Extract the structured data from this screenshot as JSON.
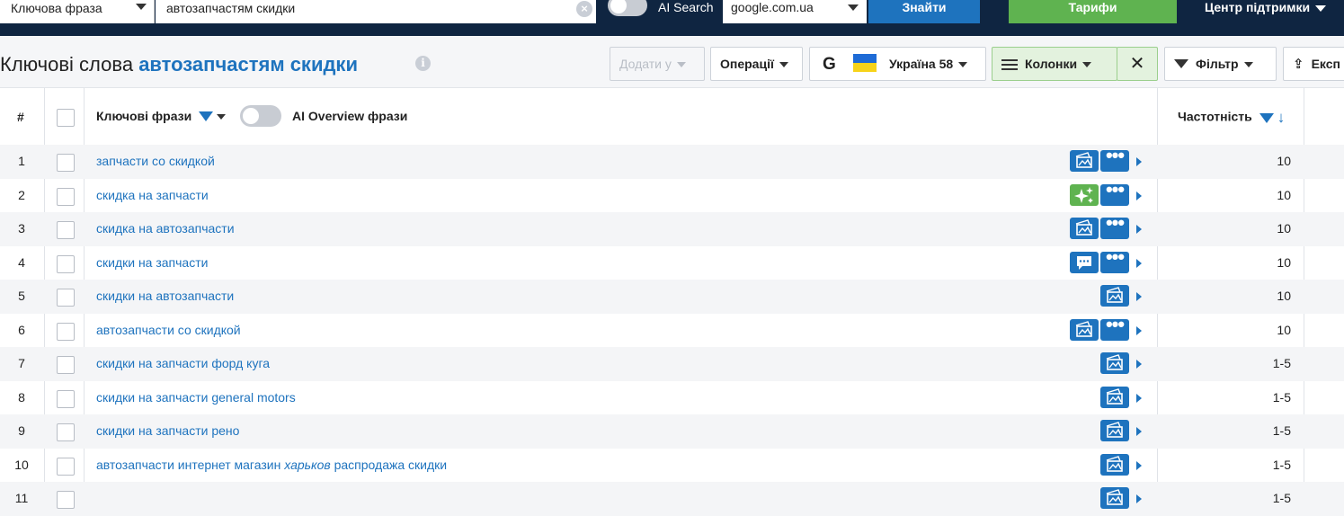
{
  "search": {
    "query_type": "Ключова фраза",
    "query": "автозапчастям скидки",
    "ai_search_label": "AI Search",
    "engine": "google.com.ua",
    "find_label": "Знайти",
    "plans_label": "Тарифи",
    "support_label": "Центр підтримки"
  },
  "header": {
    "title_prefix": "Ключові слова",
    "title_keyword": "автозапчастям скидки",
    "info_glyph": "i",
    "add_to_label": "Додати у",
    "operations_label": "Операції",
    "engine_letter": "G",
    "region_label": "Україна 58",
    "columns_label": "Колонки",
    "columns_close": "✕",
    "filter_label": "Фільтр",
    "export_label": "Експ",
    "export_icon": "upload-icon"
  },
  "table": {
    "col_num": "#",
    "col_keywords": "Ключові фрази",
    "col_aio": "AI Overview фрази",
    "col_freq": "Частотність",
    "sort_arrow": "↓",
    "rows": [
      {
        "num": "1",
        "kw": "запчасти со скидкой",
        "kw_italic": "",
        "kw_tail": "",
        "icon": "serp-features-icon",
        "more": true,
        "freq": "10"
      },
      {
        "num": "2",
        "kw": "скидка на запчасти",
        "kw_italic": "",
        "kw_tail": "",
        "icon": "ai-sparkle-icon",
        "more": true,
        "freq": "10"
      },
      {
        "num": "3",
        "kw": "скидка на автозапчасти",
        "kw_italic": "",
        "kw_tail": "",
        "icon": "serp-features-icon",
        "more": true,
        "freq": "10"
      },
      {
        "num": "4",
        "kw": "скидки на запчасти",
        "kw_italic": "",
        "kw_tail": "",
        "icon": "chat-icon",
        "more": true,
        "freq": "10"
      },
      {
        "num": "5",
        "kw": "скидки на автозапчасти",
        "kw_italic": "",
        "kw_tail": "",
        "icon": "serp-features-icon",
        "more": false,
        "freq": "10"
      },
      {
        "num": "6",
        "kw": "автозапчасти со скидкой",
        "kw_italic": "",
        "kw_tail": "",
        "icon": "serp-features-icon",
        "more": true,
        "freq": "10"
      },
      {
        "num": "7",
        "kw": "скидки на запчасти форд куга",
        "kw_italic": "",
        "kw_tail": "",
        "icon": "serp-features-icon",
        "more": false,
        "freq": "1-5"
      },
      {
        "num": "8",
        "kw": "скидки на запчасти general motors",
        "kw_italic": "",
        "kw_tail": "",
        "icon": "serp-features-icon",
        "more": false,
        "freq": "1-5"
      },
      {
        "num": "9",
        "kw": "скидки на запчасти рено",
        "kw_italic": "",
        "kw_tail": "",
        "icon": "serp-features-icon",
        "more": false,
        "freq": "1-5"
      },
      {
        "num": "10",
        "kw": "автозапчасти интернет магазин ",
        "kw_italic": "харьков",
        "kw_tail": " распродажа скидки",
        "icon": "serp-features-icon",
        "more": false,
        "freq": "1-5"
      },
      {
        "num": "11",
        "kw": "",
        "kw_italic": "",
        "kw_tail": "",
        "icon": "serp-features-icon",
        "more": false,
        "freq": "1-5"
      }
    ]
  },
  "colors": {
    "topbar": "#0f2541",
    "accent": "#1e73be",
    "green": "#5fb350",
    "row_alt": "#f4f5f7"
  }
}
